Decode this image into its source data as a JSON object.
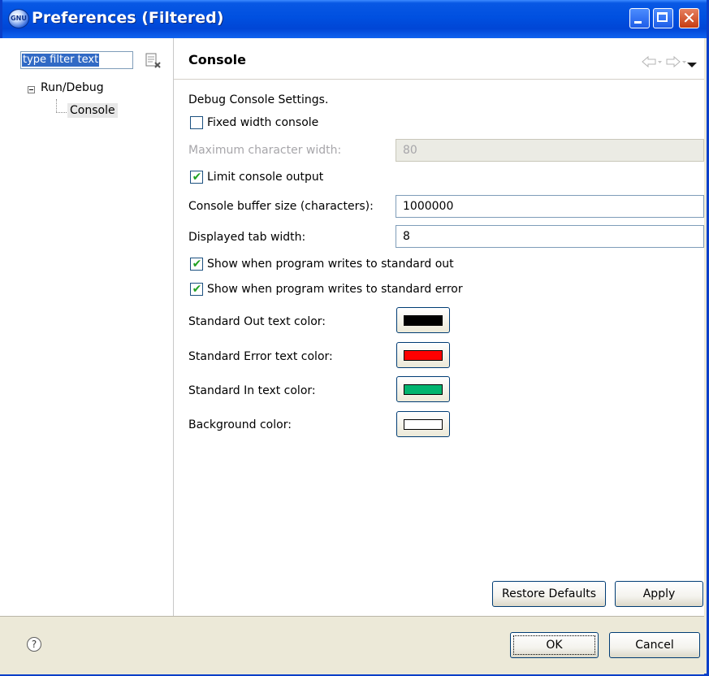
{
  "window": {
    "title": "Preferences (Filtered)",
    "app_icon": "eclipse-sphere-icon",
    "app_icon_text": "GNU",
    "controls": {
      "minimize": "minimize-icon",
      "maximize": "maximize-icon",
      "close": "close-icon",
      "close_glyph": "✕"
    }
  },
  "filter": {
    "value": "type filter text",
    "clear_icon": "clear-filter-icon"
  },
  "tree": {
    "items": [
      {
        "label": "Run/Debug",
        "expanded": true
      },
      {
        "label": "Console",
        "selected": true
      }
    ],
    "collapse_glyph": "−"
  },
  "page": {
    "title": "Console",
    "nav": {
      "back": "back-arrow-icon",
      "forward": "forward-arrow-icon",
      "menu": "view-menu-icon"
    },
    "section_label": "Debug Console Settings.",
    "settings": {
      "fixed_width": {
        "label": "Fixed width console",
        "checked": false
      },
      "max_char_width": {
        "label": "Maximum character width:",
        "value": "80",
        "enabled": false
      },
      "limit_output": {
        "label": "Limit console output",
        "checked": true,
        "check_glyph": "✔"
      },
      "buffer_size": {
        "label": "Console buffer size (characters):",
        "value": "1000000"
      },
      "tab_width": {
        "label": "Displayed tab width:",
        "value": "8"
      },
      "show_stdout": {
        "label": "Show when program writes to standard out",
        "checked": true,
        "check_glyph": "✔"
      },
      "show_stderr": {
        "label": "Show when program writes to standard error",
        "checked": true,
        "check_glyph": "✔"
      }
    },
    "colors": [
      {
        "label": "Standard Out text color:",
        "color": "#000000"
      },
      {
        "label": "Standard Error text color:",
        "color": "#ff0000"
      },
      {
        "label": "Standard In text color:",
        "color": "#00b46e"
      },
      {
        "label": "Background color:",
        "color": "#ffffff"
      }
    ],
    "buttons": {
      "restore_defaults": "Restore Defaults",
      "apply": "Apply"
    }
  },
  "footer": {
    "help_glyph": "?",
    "ok": "OK",
    "cancel": "Cancel"
  },
  "theme": {
    "title_bar": "#0050e0",
    "border": "#0a3fc9",
    "dialog_bg": "#ece9d8",
    "selection": "#316ac5",
    "check_color": "#21a121"
  }
}
